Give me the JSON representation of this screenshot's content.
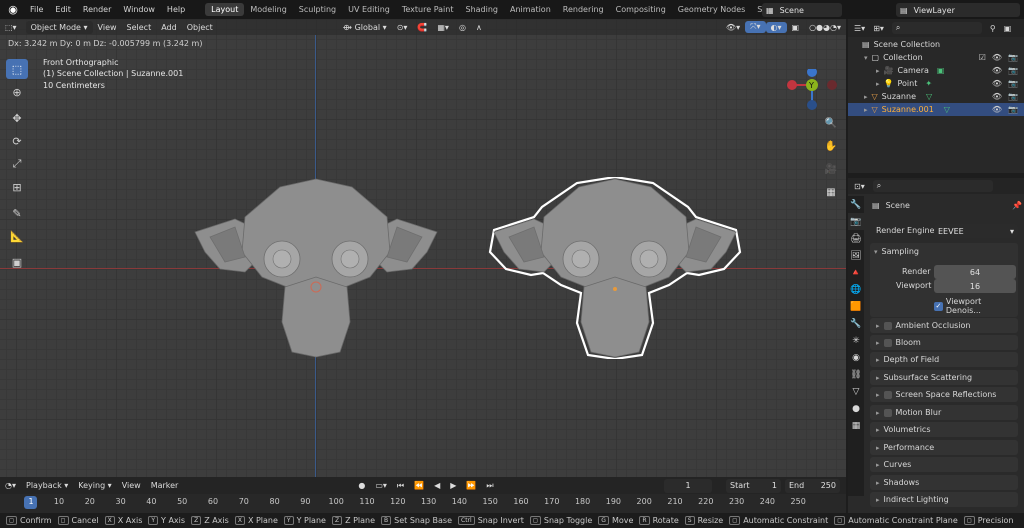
{
  "menu": {
    "items": [
      "File",
      "Edit",
      "Render",
      "Window",
      "Help"
    ],
    "workspaces": [
      "Layout",
      "Modeling",
      "Sculpting",
      "UV Editing",
      "Texture Paint",
      "Shading",
      "Animation",
      "Rendering",
      "Compositing",
      "Geometry Nodes",
      "Scripting"
    ],
    "active_workspace": "Layout",
    "add_tab": "+",
    "scene": "Scene",
    "view_layer": "ViewLayer"
  },
  "viewport": {
    "header": {
      "mode": "Object Mode",
      "view": "View",
      "select": "Select",
      "add": "Add",
      "object": "Object",
      "orientation": "Global"
    },
    "status_line": "Dx: 3.242 m   Dy: 0 m   Dz: -0.005799 m (3.242 m)",
    "overlay": {
      "view_name": "Front Orthographic",
      "collection": "(1) Scene Collection | Suzanne.001",
      "scale": "10 Centimeters"
    },
    "gizmo": {
      "x": "X",
      "y": "Y",
      "z": "Z"
    }
  },
  "outliner": {
    "rows": [
      {
        "label": "Scene Collection",
        "icon": "scene-collection-icon"
      },
      {
        "label": "Collection",
        "icon": "collection-icon"
      },
      {
        "label": "Camera",
        "icon": "camera-icon"
      },
      {
        "label": "Point",
        "icon": "light-icon"
      },
      {
        "label": "Suzanne",
        "icon": "mesh-icon"
      },
      {
        "label": "Suzanne.001",
        "icon": "mesh-icon",
        "selected": true
      }
    ]
  },
  "properties": {
    "scene_name": "Scene",
    "render_engine_label": "Render Engine",
    "render_engine": "EEVEE",
    "sampling": {
      "title": "Sampling",
      "render_label": "Render",
      "render_value": "64",
      "viewport_label": "Viewport",
      "viewport_value": "16",
      "denoise_label": "Viewport Denois..."
    },
    "panels": [
      {
        "label": "Ambient Occlusion",
        "checkbox": true
      },
      {
        "label": "Bloom",
        "checkbox": true
      },
      {
        "label": "Depth of Field",
        "checkbox": false
      },
      {
        "label": "Subsurface Scattering",
        "checkbox": false
      },
      {
        "label": "Screen Space Reflections",
        "checkbox": true
      },
      {
        "label": "Motion Blur",
        "checkbox": true
      },
      {
        "label": "Volumetrics",
        "checkbox": false
      },
      {
        "label": "Performance",
        "checkbox": false
      },
      {
        "label": "Curves",
        "checkbox": false
      },
      {
        "label": "Shadows",
        "checkbox": false
      },
      {
        "label": "Indirect Lighting",
        "checkbox": false
      }
    ]
  },
  "timeline": {
    "playback": "Playback",
    "keying": "Keying",
    "view": "View",
    "marker": "Marker",
    "current_frame": "1",
    "start_label": "Start",
    "start": "1",
    "end_label": "End",
    "end": "250",
    "ticks": [
      "1",
      "10",
      "20",
      "30",
      "40",
      "50",
      "60",
      "70",
      "80",
      "90",
      "100",
      "110",
      "120",
      "130",
      "140",
      "150",
      "160",
      "170",
      "180",
      "190",
      "200",
      "210",
      "220",
      "230",
      "240",
      "250"
    ]
  },
  "status_bar": [
    {
      "key": "",
      "label": "Confirm"
    },
    {
      "key": "",
      "label": "Cancel"
    },
    {
      "key": "X",
      "label": "X Axis"
    },
    {
      "key": "Y",
      "label": "Y Axis"
    },
    {
      "key": "Z",
      "label": "Z Axis"
    },
    {
      "key": "X",
      "label": "X Plane"
    },
    {
      "key": "Y",
      "label": "Y Plane"
    },
    {
      "key": "Z",
      "label": "Z Plane"
    },
    {
      "key": "B",
      "label": "Set Snap Base"
    },
    {
      "key": "Ctrl",
      "label": "Snap Invert"
    },
    {
      "key": "",
      "label": "Snap Toggle"
    },
    {
      "key": "G",
      "label": "Move"
    },
    {
      "key": "R",
      "label": "Rotate"
    },
    {
      "key": "S",
      "label": "Resize"
    },
    {
      "key": "",
      "label": "Automatic Constraint"
    },
    {
      "key": "",
      "label": "Automatic Constraint Plane"
    },
    {
      "key": "",
      "label": "Precision"
    }
  ],
  "colors": {
    "accent": "#4772b3",
    "selected_outline": "#ffffff",
    "x_axis": "#c2353f",
    "y_axis": "#8bb31c",
    "z_axis": "#3a75cc"
  }
}
